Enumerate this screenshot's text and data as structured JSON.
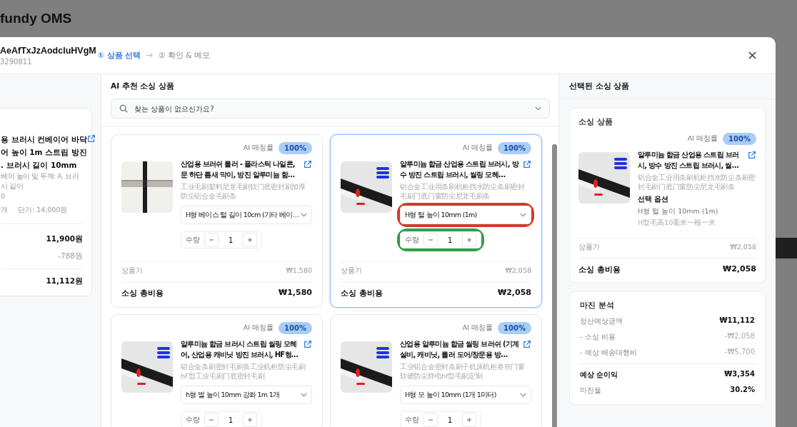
{
  "app_title": "fundy OMS",
  "modal": {
    "title": "AeAfTxJzAodcluHVgM",
    "subtitle": "3290811",
    "steps": [
      {
        "number": "①",
        "label": "상품 선택",
        "selected": true
      },
      {
        "number": "②",
        "label": "확인 & 메모",
        "selected": false
      }
    ]
  },
  "order": {
    "title_lines": [
      "용 브러시 컨베이어 바닥",
      "어 높이 1m 스트립 방진",
      ". 브러시 길이 10mm"
    ],
    "option_lines": [
      "베어 높이 및 두께: A. 브러시 길이",
      "0"
    ],
    "quantity": "개",
    "unit_price": "단가: 14,000원",
    "amounts": [
      {
        "value": "11,900원",
        "kind": "subtotal"
      },
      {
        "value": "-788원",
        "kind": "discount"
      },
      {
        "value": "11,112원",
        "kind": "total"
      }
    ]
  },
  "recommendations": {
    "title": "AI 추천 소싱 상품",
    "search": {
      "placeholder": "찾는 상품이 없으신가요?"
    },
    "products": [
      {
        "match_label": "AI 매칭률",
        "match": "100%",
        "title": "산업용 브러쉬 롤러 - 플라스틱 나일론, 문 하단 틈새 막이, 방진 알루미늄 함…",
        "source_title": "工业毛刷塑料尼龙毛刷软门底密封刷加厚防尘铝合金毛刷条",
        "option": "H형 베이스 털 길이 10cm (기타 베이…",
        "quantity_label": "수량",
        "quantity": "1",
        "price_label": "상품가",
        "price": "₩1,580",
        "total_label": "소싱 총비용",
        "total": "₩1,580",
        "selected": false,
        "option_highlighted": false,
        "quantity_highlighted": false
      },
      {
        "match_label": "AI 매칭률",
        "match": "100%",
        "title": "알루미늄 합금 산업용 스트립 브러시, 방수 방진 스트립 브러시, 씰링 모헤…",
        "source_title": "铝合金工业用条刷机柜挡水防尘条刷密封毛刷门底门窗防尘尼龙毛刷条",
        "option": "H형 털 높이 10mm (1m)",
        "quantity_label": "수량",
        "quantity": "1",
        "price_label": "상품가",
        "price": "₩2,058",
        "total_label": "소싱 총비용",
        "total": "₩2,058",
        "selected": true,
        "option_highlighted": true,
        "quantity_highlighted": true
      },
      {
        "match_label": "AI 매칭률",
        "match": "100%",
        "title": "알루미늄 합금 브러시 스트립 씰링 모헤어, 산업용 캐비닛 방진 브러시, HF형…",
        "source_title": "铝合金条刷密封毛刷条工业机柜防尘毛刷hF型工业毛刷门底密封毛刷",
        "option": "h형 벌 높이 10mm 강화 1m 1개",
        "quantity_label": "수량",
        "quantity": "1",
        "selected": false,
        "option_highlighted": false,
        "quantity_highlighted": false
      },
      {
        "match_label": "AI 매칭률",
        "match": "100%",
        "title": "산업용 알루미늄 합금 씰링 브러쉬 (기계 설비, 캐비닛, 롤러 도어/창문용 방…",
        "source_title": "工业铝合金密封条刷子机床机柜卷帘门窗软硬防尘静电hf型毛刷定制",
        "option": "H형 모 높이 10mm (1개 1미터)",
        "quantity_label": "수량",
        "quantity": "1",
        "selected": false,
        "option_highlighted": false,
        "quantity_highlighted": false
      }
    ]
  },
  "selected_panel": {
    "title": "선택된 소싱 상품",
    "card_title": "소싱 상품",
    "product": {
      "match_label": "AI 매칭률",
      "match": "100%",
      "title": "알루미늄 합금 산업용 스트립 브러시, 방수 방진 스트립 브러시, 씰…",
      "source_title": "铝合金工业用条刷机柜挡水防尘条刷密封毛刷门底门窗防尘尼龙毛刷条",
      "option_label": "선택 옵션",
      "option": "H형 털 높이 10mm (1m)",
      "option_source": "H型毛高10毫米一根一米",
      "price_label": "상품가",
      "price": "₩2,058",
      "total_label": "소싱 총비용",
      "total": "₩2,058"
    },
    "margin": {
      "title": "마진 분석",
      "rows": [
        {
          "label": "정산예상금액",
          "value": "₩11,112",
          "kind": "settlement"
        },
        {
          "label": "- 소싱 비용",
          "value": "-₩2,058",
          "kind": "cost"
        },
        {
          "label": "- 예상 배송대행비",
          "value": "-₩5,700",
          "kind": "cost"
        },
        {
          "label": "예상 순이익",
          "value": "₩3,354",
          "kind": "profit"
        },
        {
          "label": "마진율",
          "value": "30.2%",
          "kind": "rate"
        }
      ]
    }
  }
}
